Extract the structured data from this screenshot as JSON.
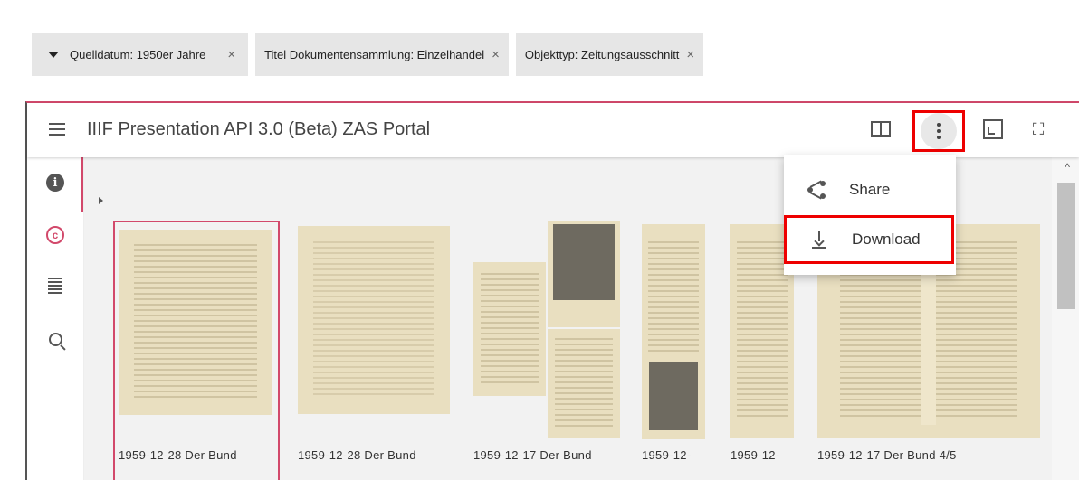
{
  "filters": [
    {
      "label": "Quelldatum: 1950er Jahre",
      "remove": "×"
    },
    {
      "label": "Titel Dokumentensammlung: Einzelhandel",
      "remove": "×"
    },
    {
      "label": "Objekttyp: Zeitungsausschnitt",
      "remove": "×"
    }
  ],
  "viewer": {
    "title": "IIIF Presentation API 3.0 (Beta) ZAS Portal",
    "toolbar_icons": [
      "book-view-icon",
      "more-vert-icon",
      "window-icon",
      "fullscreen-icon"
    ],
    "rail_icons": [
      "info-icon",
      "copyright-icon",
      "list-icon",
      "search-icon"
    ]
  },
  "menu": {
    "share_label": "Share",
    "download_label": "Download"
  },
  "thumbnails": [
    {
      "label": "1959-12-28 Der Bund"
    },
    {
      "label": "1959-12-28 Der Bund"
    },
    {
      "label": "1959-12-17 Der Bund"
    },
    {
      "label": "1959-12-"
    },
    {
      "label": "1959-12-"
    },
    {
      "label": "1959-12-17 Der Bund 4/5"
    }
  ],
  "colors": {
    "accent": "#d2496b",
    "highlight": "#ee0000",
    "paper": "#e9dfc0"
  }
}
